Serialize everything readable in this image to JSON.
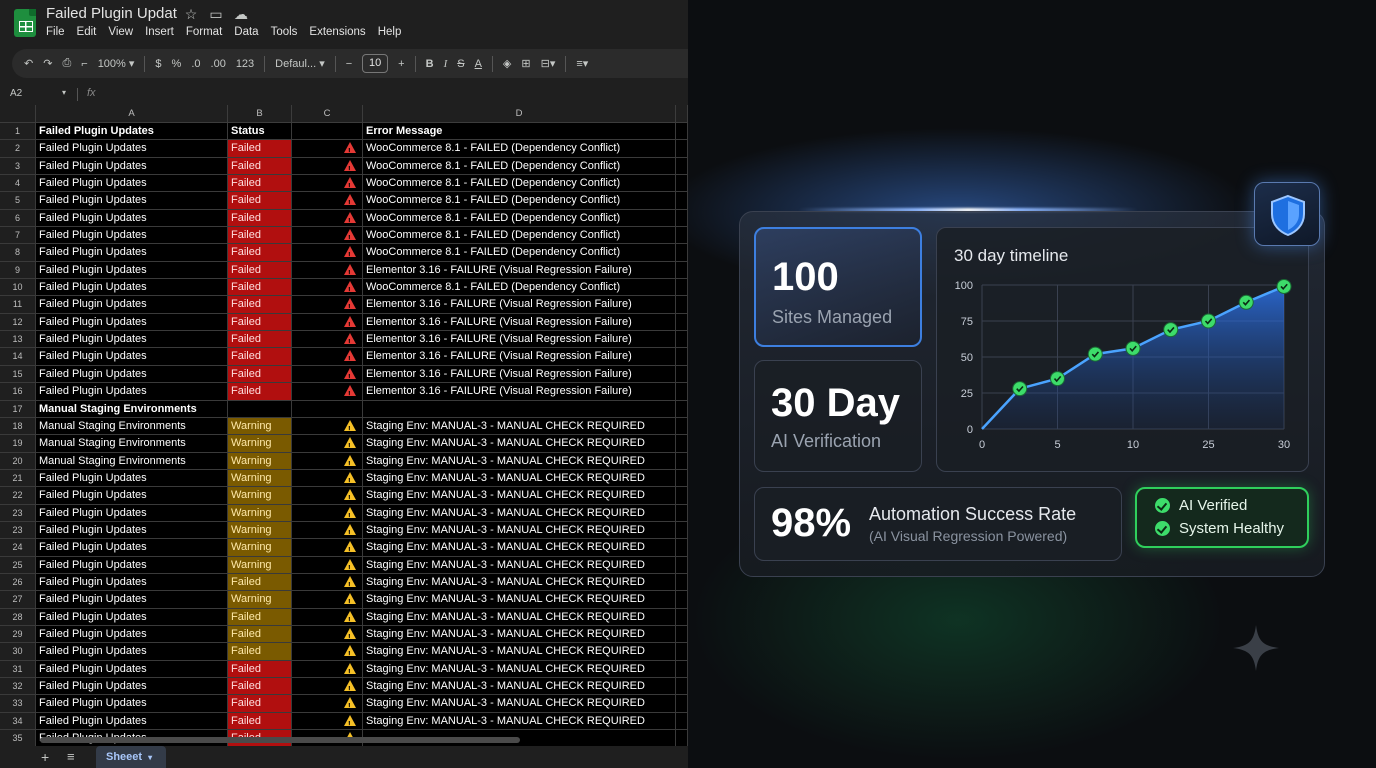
{
  "sheet": {
    "title": "Failed Plugin Updat",
    "menu": [
      "File",
      "Edit",
      "View",
      "Insert",
      "Format",
      "Data",
      "Tools",
      "Extensions",
      "Help"
    ],
    "toolbar": {
      "zoom": "100%",
      "currency": "$",
      "percent": "%",
      "dec_down": ".0",
      "dec_up": ".00",
      "number_format": "123",
      "font": "Defaul...",
      "font_size": "10"
    },
    "name_box": "A2",
    "fx_label": "fx",
    "columns": [
      "A",
      "B",
      "C",
      "D"
    ],
    "rows": [
      {
        "n": "1",
        "a": "Failed Plugin Updates",
        "b": "Status",
        "d": "Error Message",
        "bold": true,
        "status": "none",
        "sev": "none"
      },
      {
        "n": "2",
        "a": "Failed Plugin Updates",
        "b": "Failed",
        "d": "WooCommerce 8.1 - FAILED (Dependency Conflict)",
        "status": "failed",
        "sev": "error"
      },
      {
        "n": "3",
        "a": "Failed Plugin Updates",
        "b": "Failed",
        "d": "WooCommerce 8.1 - FAILED (Dependency Conflict)",
        "status": "failed",
        "sev": "error"
      },
      {
        "n": "4",
        "a": "Failed Plugin Updates",
        "b": "Failed",
        "d": "WooCommerce 8.1 - FAILED (Dependency Conflict)",
        "status": "failed",
        "sev": "error"
      },
      {
        "n": "5",
        "a": "Failed Plugin Updates",
        "b": "Failed",
        "d": "WooCommerce 8.1 - FAILED (Dependency Conflict)",
        "status": "failed",
        "sev": "error"
      },
      {
        "n": "6",
        "a": "Failed Plugin Updates",
        "b": "Failed",
        "d": "WooCommerce 8.1 - FAILED (Dependency Conflict)",
        "status": "failed",
        "sev": "error"
      },
      {
        "n": "7",
        "a": "Failed Plugin Updates",
        "b": "Failed",
        "d": "WooCommerce 8.1 - FAILED (Dependency Conflict)",
        "status": "failed",
        "sev": "error"
      },
      {
        "n": "8",
        "a": "Failed Plugin Updates",
        "b": "Failed",
        "d": "WooCommerce 8.1 - FAILED (Dependency Conflict)",
        "status": "failed",
        "sev": "error"
      },
      {
        "n": "9",
        "a": "Failed Plugin Updates",
        "b": "Failed",
        "d": "Elementor 3.16 - FAILURE (Visual Regression Failure)",
        "status": "failed",
        "sev": "error"
      },
      {
        "n": "10",
        "a": "Failed Plugin Updates",
        "b": "Failed",
        "d": "WooCommerce 8.1 - FAILED (Dependency Conflict)",
        "status": "failed",
        "sev": "error"
      },
      {
        "n": "11",
        "a": "Failed Plugin Updates",
        "b": "Failed",
        "d": "Elementor 3.16 - FAILURE (Visual Regression Failure)",
        "status": "failed",
        "sev": "error"
      },
      {
        "n": "12",
        "a": "Failed Plugin Updates",
        "b": "Failed",
        "d": "Elementor 3.16 - FAILURE (Visual Regression Failure)",
        "status": "failed",
        "sev": "error"
      },
      {
        "n": "13",
        "a": "Failed Plugin Updates",
        "b": "Failed",
        "d": "Elementor 3.16 - FAILURE (Visual Regression Failure)",
        "status": "failed",
        "sev": "error"
      },
      {
        "n": "14",
        "a": "Failed Plugin Updates",
        "b": "Failed",
        "d": "Elementor 3.16 - FAILURE (Visual Regression Failure)",
        "status": "failed",
        "sev": "error"
      },
      {
        "n": "15",
        "a": "Failed Plugin Updates",
        "b": "Failed",
        "d": "Elementor 3.16 - FAILURE (Visual Regression Failure)",
        "status": "failed",
        "sev": "error"
      },
      {
        "n": "16",
        "a": "Failed Plugin Updates",
        "b": "Failed",
        "d": "Elementor 3.16 - FAILURE (Visual Regression Failure)",
        "status": "failed",
        "sev": "error"
      },
      {
        "n": "17",
        "a": "Manual Staging Environments",
        "b": "",
        "d": "",
        "bold": true,
        "status": "none",
        "sev": "none"
      },
      {
        "n": "18",
        "a": "Manual Staging Environments",
        "b": "Warning",
        "d": "Staging Env: MANUAL-3 - MANUAL CHECK REQUIRED",
        "status": "warning",
        "sev": "warn"
      },
      {
        "n": "19",
        "a": "Manual Staging Environments",
        "b": "Warning",
        "d": "Staging Env: MANUAL-3 - MANUAL CHECK REQUIRED",
        "status": "warning",
        "sev": "warn"
      },
      {
        "n": "20",
        "a": "Manual Staging Environments",
        "b": "Warning",
        "d": "Staging Env: MANUAL-3 - MANUAL CHECK REQUIRED",
        "status": "warning",
        "sev": "warn"
      },
      {
        "n": "21",
        "a": "Failed Plugin Updates",
        "b": "Warning",
        "d": "Staging Env: MANUAL-3 - MANUAL CHECK REQUIRED",
        "status": "warning",
        "sev": "warn"
      },
      {
        "n": "22",
        "a": "Failed Plugin Updates",
        "b": "Warning",
        "d": "Staging Env: MANUAL-3 - MANUAL CHECK REQUIRED",
        "status": "warning",
        "sev": "warn"
      },
      {
        "n": "23",
        "a": "Failed Plugin Updates",
        "b": "Warning",
        "d": "Staging Env: MANUAL-3 - MANUAL CHECK REQUIRED",
        "status": "warning",
        "sev": "warn"
      },
      {
        "n": "23",
        "a": "Failed Plugin Updates",
        "b": "Warning",
        "d": "Staging Env: MANUAL-3 - MANUAL CHECK REQUIRED",
        "status": "warning",
        "sev": "warn"
      },
      {
        "n": "24",
        "a": "Failed Plugin Updates",
        "b": "Warning",
        "d": "Staging Env: MANUAL-3 - MANUAL CHECK REQUIRED",
        "status": "warning",
        "sev": "warn"
      },
      {
        "n": "25",
        "a": "Failed Plugin Updates",
        "b": "Warning",
        "d": "Staging Env: MANUAL-3 - MANUAL CHECK REQUIRED",
        "status": "warning",
        "sev": "warn"
      },
      {
        "n": "26",
        "a": "Failed Plugin Updates",
        "b": "Failed",
        "d": "Staging Env: MANUAL-3 - MANUAL CHECK REQUIRED",
        "status": "warning",
        "sev": "warn"
      },
      {
        "n": "27",
        "a": "Failed Plugin Updates",
        "b": "Warning",
        "d": "Staging Env: MANUAL-3 - MANUAL CHECK REQUIRED",
        "status": "warning",
        "sev": "warn"
      },
      {
        "n": "28",
        "a": "Failed Plugin Updates",
        "b": "Failed",
        "d": "Staging Env: MANUAL-3 - MANUAL CHECK REQUIRED",
        "status": "warning",
        "sev": "warn"
      },
      {
        "n": "29",
        "a": "Failed Plugin Updates",
        "b": "Failed",
        "d": "Staging Env: MANUAL-3 - MANUAL CHECK REQUIRED",
        "status": "warning",
        "sev": "warn"
      },
      {
        "n": "30",
        "a": "Failed Plugin Updates",
        "b": "Failed",
        "d": "Staging Env: MANUAL-3 - MANUAL CHECK REQUIRED",
        "status": "warning",
        "sev": "warn"
      },
      {
        "n": "31",
        "a": "Failed Plugin Updates",
        "b": "Failed",
        "d": "Staging Env: MANUAL-3 - MANUAL CHECK REQUIRED",
        "status": "failed",
        "sev": "warn"
      },
      {
        "n": "32",
        "a": "Failed Plugin Updates",
        "b": "Failed",
        "d": "Staging Env: MANUAL-3 - MANUAL CHECK REQUIRED",
        "status": "failed",
        "sev": "warn"
      },
      {
        "n": "33",
        "a": "Failed Plugin Updates",
        "b": "Failed",
        "d": "Staging Env: MANUAL-3 - MANUAL CHECK REQUIRED",
        "status": "failed",
        "sev": "warn"
      },
      {
        "n": "34",
        "a": "Failed Plugin Updates",
        "b": "Failed",
        "d": "Staging Env: MANUAL-3 - MANUAL CHECK REQUIRED",
        "status": "failed",
        "sev": "warn"
      },
      {
        "n": "35",
        "a": "Failed Plugin Updates",
        "b": "Failed",
        "d": "",
        "status": "failed",
        "sev": "warn"
      }
    ],
    "sheet_tab": "Sheeet",
    "colors": {
      "failed": "#b10f0f",
      "warning": "#7a5a00",
      "sheet_bg": "#1f1f1f"
    }
  },
  "dashboard": {
    "sites": {
      "value": "100",
      "label": "Sites Managed"
    },
    "verify": {
      "value": "30 Day",
      "label": "AI Verification"
    },
    "rate": {
      "value": "98%",
      "label": "Automation Success Rate",
      "sublabel": "(AI Visual Regression Powered)"
    },
    "health": {
      "items": [
        "AI Verified",
        "System Healthy"
      ]
    },
    "icons": {
      "shield": "shield-icon",
      "sparkle": "sparkle-icon",
      "check": "check-icon"
    },
    "colors": {
      "accent": "#3d7fe0",
      "success": "#3ddc6a",
      "line": "#4aa3ff"
    }
  },
  "chart_data": {
    "type": "line",
    "title": "30 day timeline",
    "x_ticks": [
      "0",
      "5",
      "10",
      "25",
      "30"
    ],
    "y_ticks": [
      "0",
      "25",
      "50",
      "75",
      "100"
    ],
    "ylim": [
      0,
      100
    ],
    "points": [
      {
        "x": 0,
        "y": 0
      },
      {
        "x": 1,
        "y": 28
      },
      {
        "x": 2,
        "y": 35
      },
      {
        "x": 3,
        "y": 52
      },
      {
        "x": 4,
        "y": 56
      },
      {
        "x": 5,
        "y": 69
      },
      {
        "x": 6,
        "y": 75
      },
      {
        "x": 7,
        "y": 88
      },
      {
        "x": 8,
        "y": 99
      }
    ],
    "x_tick_index": [
      0,
      2,
      4,
      6,
      8
    ],
    "grid": true,
    "legend": "none"
  }
}
